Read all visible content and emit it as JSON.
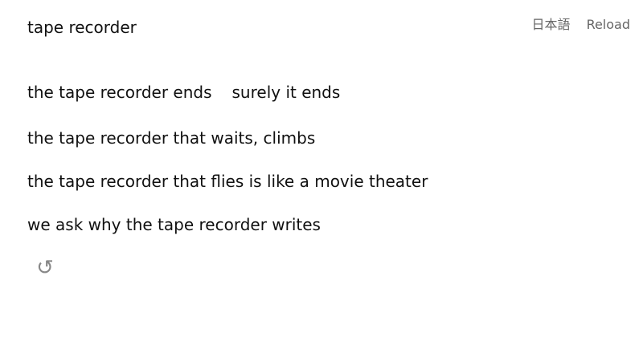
{
  "page": {
    "title": "tape recorder"
  },
  "nav": {
    "language_label": "日本語",
    "reload_label": "Reload"
  },
  "poem": {
    "lines": [
      {
        "parts": [
          "the tape recorder ends",
          "surely it ends"
        ]
      },
      {
        "parts": [
          "the tape recorder that waits, climbs"
        ]
      },
      {
        "parts": [
          "the tape recorder that flies is like a movie theater"
        ]
      },
      {
        "parts": [
          "we ask why the tape recorder writes"
        ]
      }
    ]
  },
  "icons": {
    "regenerate": {
      "name": "reload-icon",
      "glyph": "↺"
    }
  },
  "colors": {
    "text": "#111111",
    "nav": "#666666",
    "icon": "#888888"
  }
}
